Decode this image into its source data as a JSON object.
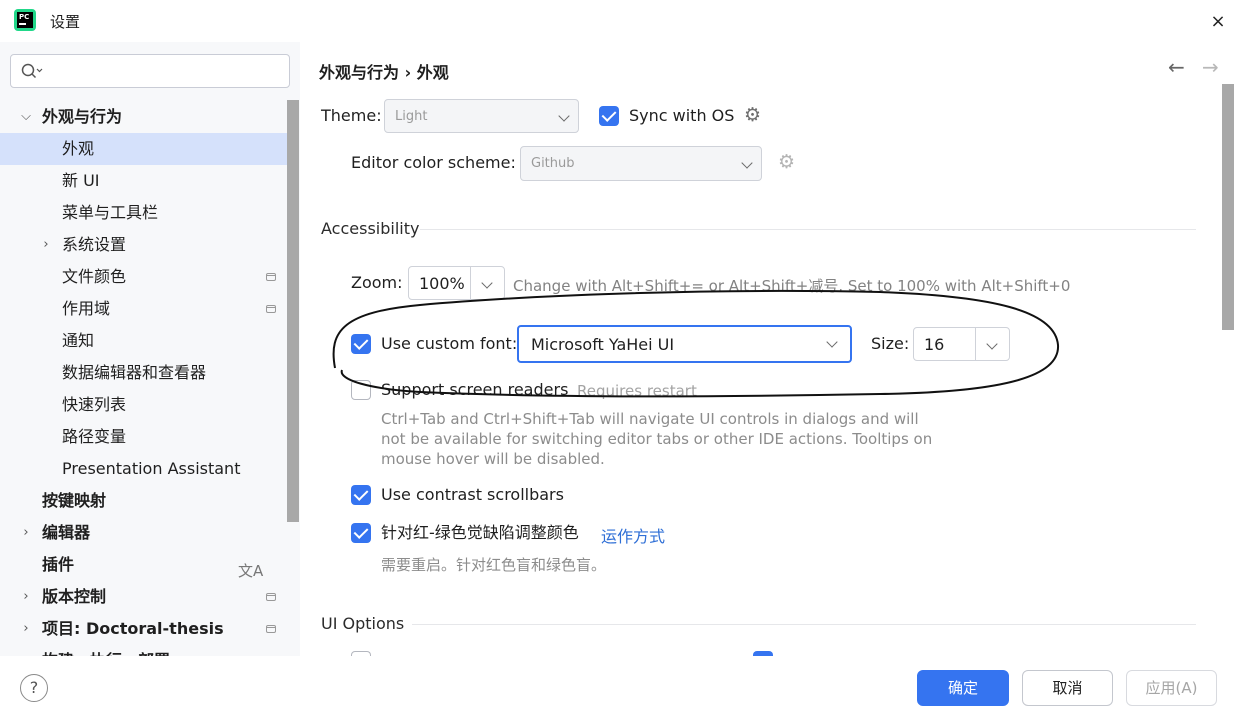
{
  "window": {
    "title": "设置",
    "close": "×"
  },
  "search": {
    "icon": "search-icon"
  },
  "tree": [
    {
      "label": "外观与行为",
      "expanded": true
    },
    {
      "label": "外观",
      "selected": true
    },
    {
      "label": "新 UI"
    },
    {
      "label": "菜单与工具栏"
    },
    {
      "label": "系统设置"
    },
    {
      "label": "文件颜色"
    },
    {
      "label": "作用域"
    },
    {
      "label": "通知"
    },
    {
      "label": "数据编辑器和查看器"
    },
    {
      "label": "快速列表"
    },
    {
      "label": "路径变量"
    },
    {
      "label": "Presentation Assistant"
    },
    {
      "label": "按键映射"
    },
    {
      "label": "编辑器"
    },
    {
      "label": "插件"
    },
    {
      "label": "版本控制"
    },
    {
      "label": "项目: Doctoral-thesis"
    },
    {
      "label": "构建、执行、部署"
    }
  ],
  "header": {
    "breadcrumb": "外观与行为 › 外观",
    "back": "←",
    "forward": "→"
  },
  "theme": {
    "label": "Theme:",
    "value": "Light",
    "sync_label": "Sync with OS",
    "sync_checked": true
  },
  "editor_scheme": {
    "label": "Editor color scheme:",
    "value": "Github"
  },
  "accessibility": {
    "title": "Accessibility",
    "zoom_label": "Zoom:",
    "zoom_value": "100%",
    "zoom_hint": "Change with Alt+Shift+= or Alt+Shift+减号. Set to 100% with Alt+Shift+0",
    "custom_font_label": "Use custom font:",
    "custom_font_checked": true,
    "font_value": "Microsoft YaHei UI",
    "size_label": "Size:",
    "size_value": "16",
    "screen_readers_label": "Support screen readers",
    "screen_readers_checked": false,
    "screen_readers_hint": "Requires restart",
    "screen_readers_desc": "Ctrl+Tab and Ctrl+Shift+Tab will navigate UI controls in dialogs and will not be available for switching editor tabs or other IDE actions. Tooltips on mouse hover will be disabled.",
    "contrast_label": "Use contrast scrollbars",
    "contrast_checked": true,
    "colorblind_label": "针对红-绿色觉缺陷调整颜色",
    "colorblind_checked": true,
    "colorblind_link": "运作方式",
    "colorblind_desc": "需要重启。针对红色盲和绿色盲。"
  },
  "ui_options": {
    "title": "UI Options"
  },
  "footer": {
    "help": "?",
    "ok": "确定",
    "cancel": "取消",
    "apply": "应用(A)"
  },
  "colors": {
    "accent": "#3574f0",
    "selection": "#d5e1fb",
    "link": "#2f6fd6"
  }
}
